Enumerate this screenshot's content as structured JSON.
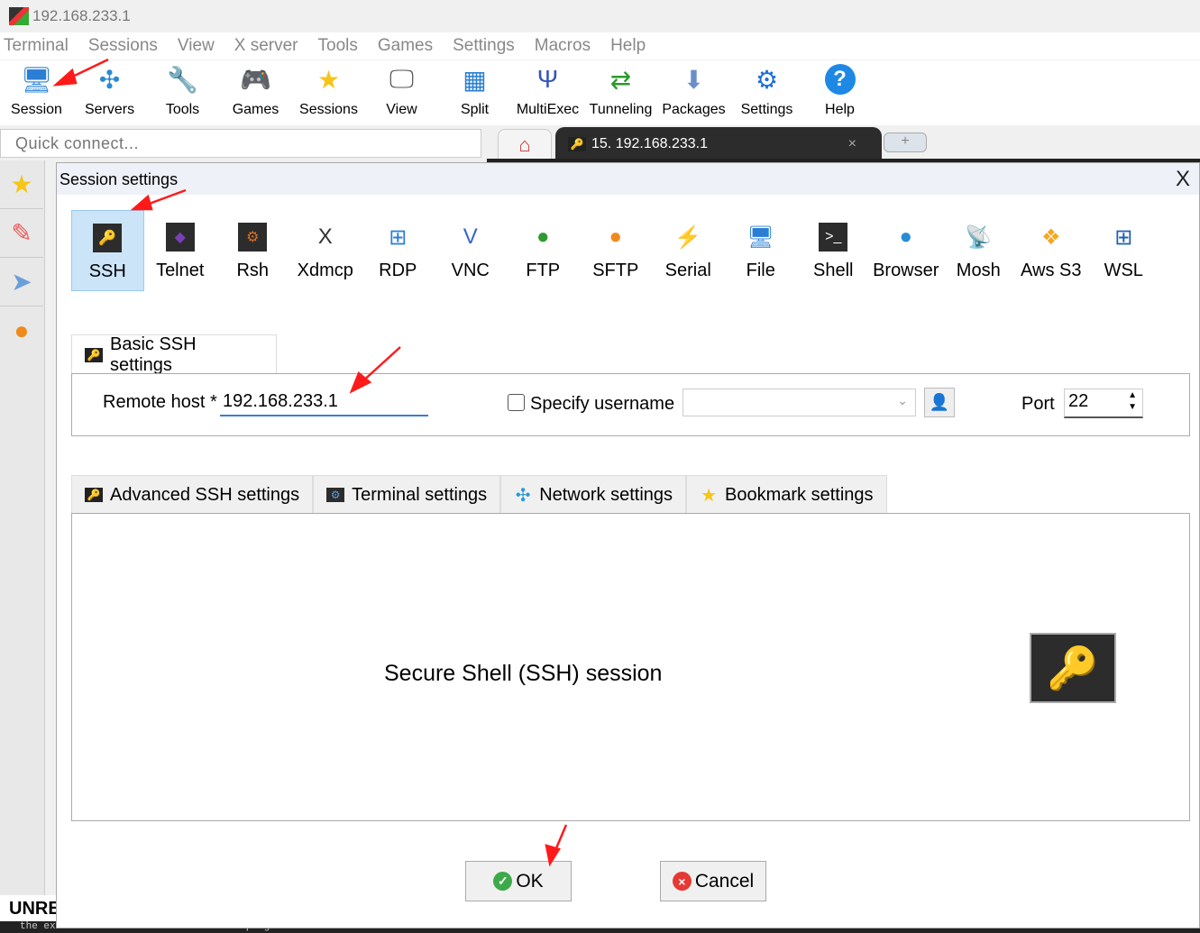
{
  "window": {
    "title": "192.168.233.1"
  },
  "menu": [
    "Terminal",
    "Sessions",
    "View",
    "X server",
    "Tools",
    "Games",
    "Settings",
    "Macros",
    "Help"
  ],
  "toolbar": [
    {
      "label": "Session",
      "icon": "session-icon",
      "glyph": "🖥"
    },
    {
      "label": "Servers",
      "icon": "servers-icon",
      "glyph": "✣"
    },
    {
      "label": "Tools",
      "icon": "tools-icon",
      "glyph": "🔧"
    },
    {
      "label": "Games",
      "icon": "games-icon",
      "glyph": "🎮"
    },
    {
      "label": "Sessions",
      "icon": "star-icon",
      "glyph": "★"
    },
    {
      "label": "View",
      "icon": "view-icon",
      "glyph": "🖵"
    },
    {
      "label": "Split",
      "icon": "split-icon",
      "glyph": "▦"
    },
    {
      "label": "MultiExec",
      "icon": "multiexec-icon",
      "glyph": "Ψ"
    },
    {
      "label": "Tunneling",
      "icon": "tunneling-icon",
      "glyph": "⇄"
    },
    {
      "label": "Packages",
      "icon": "packages-icon",
      "glyph": "⬇"
    },
    {
      "label": "Settings",
      "icon": "gear-icon",
      "glyph": "⚙"
    },
    {
      "label": "Help",
      "icon": "help-icon",
      "glyph": "?"
    }
  ],
  "quick_connect": {
    "placeholder": "Quick connect..."
  },
  "tabs": {
    "session_tab": "15. 192.168.233.1",
    "close": "×",
    "add": "+"
  },
  "dialog": {
    "title": "Session settings",
    "close": "X",
    "session_types": [
      {
        "label": "SSH",
        "glyph": "🔑",
        "color": "#222",
        "selected": true
      },
      {
        "label": "Telnet",
        "glyph": "◆",
        "color": "#7b3fb5"
      },
      {
        "label": "Rsh",
        "glyph": "⚙",
        "color": "#e07020"
      },
      {
        "label": "Xdmcp",
        "glyph": "X",
        "color": "#333"
      },
      {
        "label": "RDP",
        "glyph": "⊞",
        "color": "#2a7fd4"
      },
      {
        "label": "VNC",
        "glyph": "V",
        "color": "#3366cc"
      },
      {
        "label": "FTP",
        "glyph": "●",
        "color": "#2d9b2d"
      },
      {
        "label": "SFTP",
        "glyph": "●",
        "color": "#f08a1c"
      },
      {
        "label": "Serial",
        "glyph": "⚡",
        "color": "#777"
      },
      {
        "label": "File",
        "glyph": "🖥",
        "color": "#2a7fd4"
      },
      {
        "label": "Shell",
        "glyph": ">_",
        "color": "#222"
      },
      {
        "label": "Browser",
        "glyph": "●",
        "color": "#2a8ad4"
      },
      {
        "label": "Mosh",
        "glyph": "📡",
        "color": "#2a7fd4"
      },
      {
        "label": "Aws S3",
        "glyph": "❖",
        "color": "#f5a623"
      },
      {
        "label": "WSL",
        "glyph": "⊞",
        "color": "#1e5fb5"
      }
    ],
    "basic_tab": "Basic SSH settings",
    "remote_host_label": "Remote host *",
    "remote_host_value": "192.168.233.1",
    "specify_username_label": "Specify username",
    "specify_username_checked": false,
    "username_value": "",
    "port_label": "Port",
    "port_value": "22",
    "lower_tabs": [
      {
        "label": "Advanced SSH settings",
        "icon": "key-icon"
      },
      {
        "label": "Terminal settings",
        "icon": "terminal-icon"
      },
      {
        "label": "Network settings",
        "icon": "network-icon"
      },
      {
        "label": "Bookmark settings",
        "icon": "star-icon"
      }
    ],
    "description": "Secure Shell (SSH) session",
    "ok": "OK",
    "cancel": "Cancel"
  },
  "background": {
    "banner": "UNRE",
    "terminal_text": "the exact distribution terms for each program are described in the"
  },
  "colors": {
    "selected_bg": "#cce4f7",
    "annotation_arrow": "#ff1a1a"
  }
}
